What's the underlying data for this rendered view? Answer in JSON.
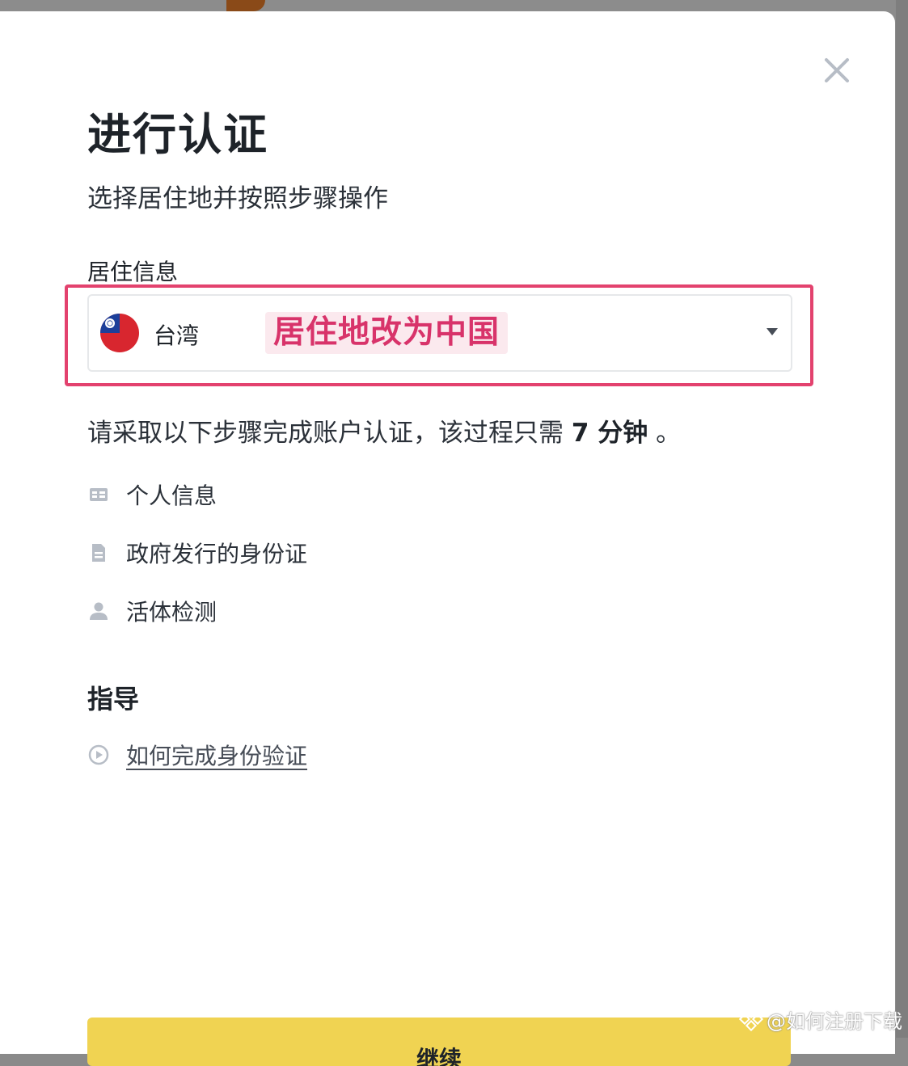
{
  "modal": {
    "title": "进行认证",
    "subtitle": "选择居住地并按照步骤操作"
  },
  "residence": {
    "label": "居住信息",
    "selected_country": "台湾",
    "flag_icon": "taiwan-flag-icon"
  },
  "annotation": {
    "text": "居住地改为中国",
    "color": "#e3426e"
  },
  "instruction": {
    "prefix": "请采取以下步骤完成账户认证，该过程只需",
    "duration": "7 分钟",
    "suffix": "。"
  },
  "steps": [
    {
      "icon": "id-card-icon",
      "label": "个人信息"
    },
    {
      "icon": "document-icon",
      "label": "政府发行的身份证"
    },
    {
      "icon": "person-icon",
      "label": "活体检测"
    }
  ],
  "guide": {
    "title": "指导",
    "link_label": "如何完成身份验证",
    "link_icon": "play-circle-icon"
  },
  "actions": {
    "continue_label": "继续",
    "close_icon": "close-icon"
  },
  "watermark": {
    "text": "@如何注册下载"
  },
  "colors": {
    "accent_yellow": "#f0d352",
    "annotation_pink": "#e3426e",
    "text_primary": "#1e2329"
  }
}
